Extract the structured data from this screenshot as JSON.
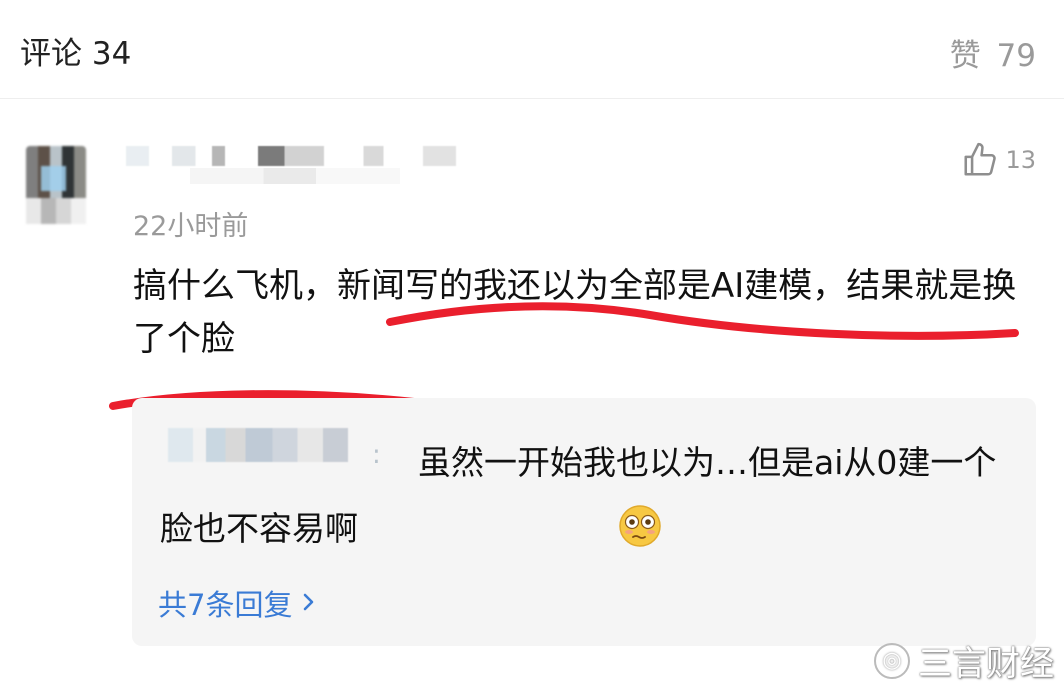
{
  "header": {
    "comments_label": "评论 34",
    "likes_label": "赞",
    "likes_count": "79"
  },
  "comment": {
    "time": "22小时前",
    "like_count": "13",
    "text": "搞什么飞机，新闻写的我还以为全部是AI建模，结果就是换了个脸"
  },
  "reply": {
    "colon": ":",
    "text": "虽然一开始我也以为…但是ai从0建一个脸也不容易啊",
    "emoji": "flushed-face-emoji",
    "more_label": "共7条回复"
  },
  "watermark": {
    "text": "三言财经",
    "icon": "weibo-icon"
  },
  "colors": {
    "accent_blue": "#3a7bd5",
    "annotation_red": "#ea1f2d",
    "muted_gray": "#9a9a9a"
  }
}
